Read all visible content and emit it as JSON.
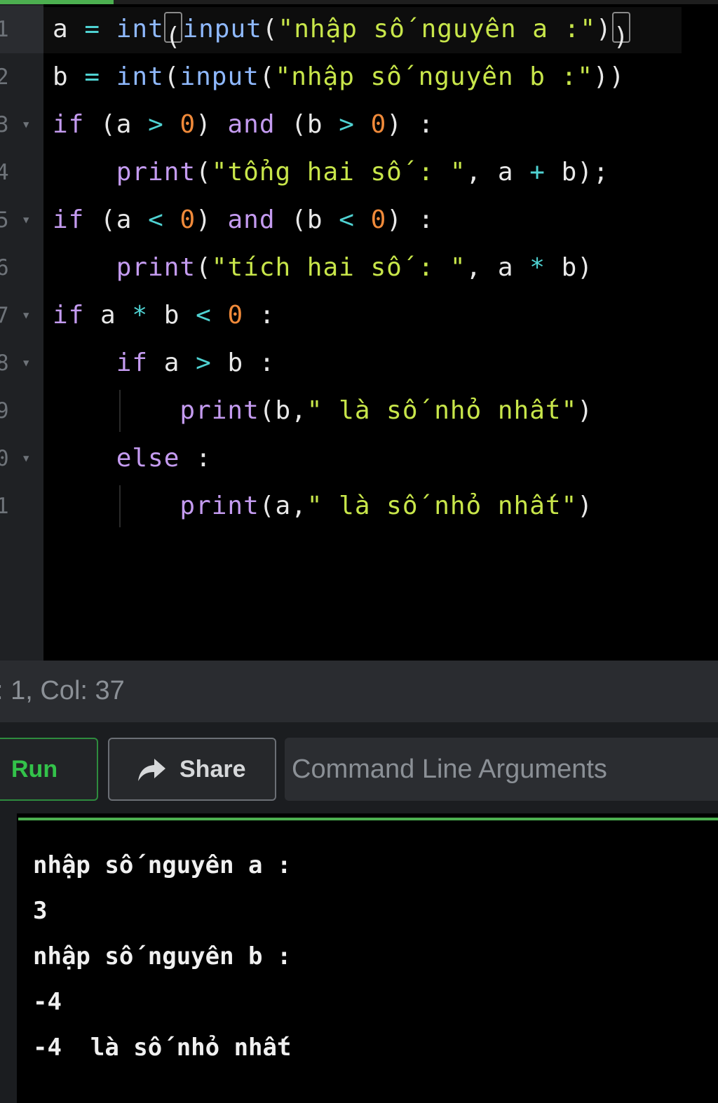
{
  "editor": {
    "active_line_index": 0,
    "lines": [
      {
        "num": "1",
        "fold": false
      },
      {
        "num": "2",
        "fold": false
      },
      {
        "num": "3",
        "fold": true
      },
      {
        "num": "4",
        "fold": false
      },
      {
        "num": "5",
        "fold": true
      },
      {
        "num": "6",
        "fold": false
      },
      {
        "num": "7",
        "fold": true
      },
      {
        "num": "8",
        "fold": true
      },
      {
        "num": "9",
        "fold": false
      },
      {
        "num": "0",
        "fold": true
      },
      {
        "num": "1",
        "fold": false
      }
    ],
    "code": [
      [
        [
          "pl",
          "a "
        ],
        [
          "op",
          "="
        ],
        [
          "pl",
          " "
        ],
        [
          "fn",
          "int"
        ],
        [
          "cur",
          "("
        ],
        [
          "fn",
          "input"
        ],
        [
          "pl",
          "("
        ],
        [
          "str",
          "\"nhập số nguyên a :\""
        ],
        [
          "pl",
          ")"
        ],
        [
          "cur",
          ")"
        ]
      ],
      [
        [
          "pl",
          "b "
        ],
        [
          "op",
          "="
        ],
        [
          "pl",
          " "
        ],
        [
          "fn",
          "int"
        ],
        [
          "pl",
          "("
        ],
        [
          "fn",
          "input"
        ],
        [
          "pl",
          "("
        ],
        [
          "str",
          "\"nhập số nguyên b :\""
        ],
        [
          "pl",
          "))"
        ]
      ],
      [
        [
          "kw",
          "if"
        ],
        [
          "pl",
          " (a "
        ],
        [
          "op",
          ">"
        ],
        [
          "pl",
          " "
        ],
        [
          "num",
          "0"
        ],
        [
          "pl",
          ") "
        ],
        [
          "kw",
          "and"
        ],
        [
          "pl",
          " (b "
        ],
        [
          "op",
          ">"
        ],
        [
          "pl",
          " "
        ],
        [
          "num",
          "0"
        ],
        [
          "pl",
          ") :"
        ]
      ],
      [
        [
          "pl",
          "    "
        ],
        [
          "kw",
          "print"
        ],
        [
          "pl",
          "("
        ],
        [
          "str",
          "\"tổng hai số : \""
        ],
        [
          "pl",
          ", a "
        ],
        [
          "op",
          "+"
        ],
        [
          "pl",
          " b);"
        ]
      ],
      [
        [
          "kw",
          "if"
        ],
        [
          "pl",
          " (a "
        ],
        [
          "op",
          "<"
        ],
        [
          "pl",
          " "
        ],
        [
          "num",
          "0"
        ],
        [
          "pl",
          ") "
        ],
        [
          "kw",
          "and"
        ],
        [
          "pl",
          " (b "
        ],
        [
          "op",
          "<"
        ],
        [
          "pl",
          " "
        ],
        [
          "num",
          "0"
        ],
        [
          "pl",
          ") :"
        ]
      ],
      [
        [
          "pl",
          "    "
        ],
        [
          "kw",
          "print"
        ],
        [
          "pl",
          "("
        ],
        [
          "str",
          "\"tích hai số : \""
        ],
        [
          "pl",
          ", a "
        ],
        [
          "op",
          "*"
        ],
        [
          "pl",
          " b)"
        ]
      ],
      [
        [
          "kw",
          "if"
        ],
        [
          "pl",
          " a "
        ],
        [
          "op",
          "*"
        ],
        [
          "pl",
          " b "
        ],
        [
          "op",
          "<"
        ],
        [
          "pl",
          " "
        ],
        [
          "num",
          "0"
        ],
        [
          "pl",
          " :"
        ]
      ],
      [
        [
          "pl",
          "    "
        ],
        [
          "kw",
          "if"
        ],
        [
          "pl",
          " a "
        ],
        [
          "op",
          ">"
        ],
        [
          "pl",
          " b :"
        ]
      ],
      [
        [
          "pl",
          "        "
        ],
        [
          "kw",
          "print"
        ],
        [
          "pl",
          "(b,"
        ],
        [
          "str",
          "\" là số nhỏ nhất\""
        ],
        [
          "pl",
          ")"
        ]
      ],
      [
        [
          "pl",
          "    "
        ],
        [
          "kw",
          "else"
        ],
        [
          "pl",
          " :"
        ]
      ],
      [
        [
          "pl",
          "        "
        ],
        [
          "kw",
          "print"
        ],
        [
          "pl",
          "(a,"
        ],
        [
          "str",
          "\" là số nhỏ nhất\""
        ],
        [
          "pl",
          ")"
        ]
      ]
    ]
  },
  "status": {
    "text": ": 1,  Col: 37"
  },
  "toolbar": {
    "run_label": "Run",
    "share_label": "Share",
    "args_placeholder": "Command Line Arguments",
    "args_value": ""
  },
  "output": {
    "lines": [
      "nhập số nguyên a :",
      "3",
      "nhập số nguyên b :",
      "-4",
      "-4  là số nhỏ nhất"
    ]
  },
  "colors": {
    "accent_green": "#4caf50",
    "run_green": "#33c24a",
    "keyword": "#c49bf0",
    "function": "#8fb9ff",
    "string": "#c8e64a",
    "number": "#f08a3a",
    "operator": "#4fd2d2"
  },
  "icons": {
    "share": "share-arrow-icon",
    "fold": "chevron-down-icon"
  }
}
